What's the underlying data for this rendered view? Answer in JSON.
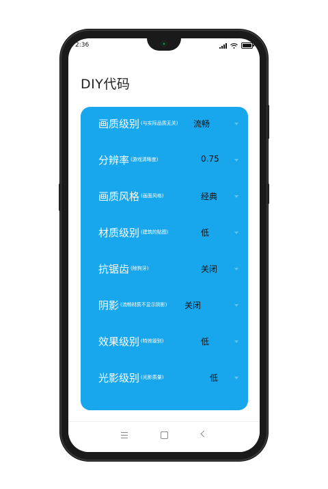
{
  "status_bar": {
    "time": "2:36"
  },
  "page": {
    "title": "DIY代码"
  },
  "settings": [
    {
      "label": "画质级别",
      "note": "(与实际品质无关)",
      "value": "流畅"
    },
    {
      "label": "分辨率",
      "note": "(游戏清晰度)",
      "value": "0.75"
    },
    {
      "label": "画质风格",
      "note": "(画面风格)",
      "value": "经典"
    },
    {
      "label": "材质级别",
      "note": "(建筑的贴图)",
      "value": "低"
    },
    {
      "label": "抗锯齿",
      "note": "(除狗牙)",
      "value": "关闭"
    },
    {
      "label": "阴影",
      "note": "(流畅材质不显示阴影)",
      "value": "关闭"
    },
    {
      "label": "效果级别",
      "note": "(特效级别)",
      "value": "低"
    },
    {
      "label": "光影级别",
      "note": "(光影质量)",
      "value": "低"
    }
  ],
  "colors": {
    "panel": "#18a6ec",
    "frame": "#1a1a1a"
  },
  "icons": [
    "signal-icon",
    "wifi-icon",
    "battery-icon",
    "menu-icon",
    "home-icon",
    "back-icon"
  ]
}
